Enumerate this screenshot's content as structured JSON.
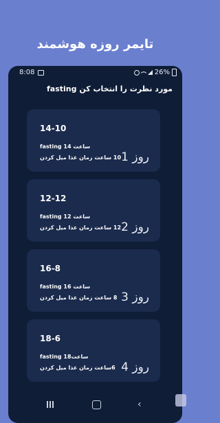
{
  "promo": {
    "title": "تایمر روزه هوشمند"
  },
  "status": {
    "time": "8:08",
    "battery": "26%"
  },
  "header": {
    "text": "مورد نظرت را انتخاب کن fasting"
  },
  "cards": [
    {
      "plan": "14-10",
      "fast_line": "fasting 14 ساعت",
      "eat_line": "10 ساعت زمان غذا میل کردن",
      "day": "روز 1"
    },
    {
      "plan": "12-12",
      "fast_line": "fasting 12 ساعت",
      "eat_line": "12 ساعت زمان غذا میل کردن",
      "day": "روز 2"
    },
    {
      "plan": "16-8",
      "fast_line": "fasting 16 ساعت",
      "eat_line": "8 ساعت زمان غذا میل کردن",
      "day": "روز 3"
    },
    {
      "plan": "18-6",
      "fast_line": "fasting 18ساعت",
      "eat_line": "6ساعت زمان غذا میل کردن",
      "day": "روز 4"
    }
  ],
  "colors": {
    "background": "#6b7fcf",
    "screen": "#0f1d36",
    "card": "#1b2b4d",
    "text": "#ffffff"
  }
}
